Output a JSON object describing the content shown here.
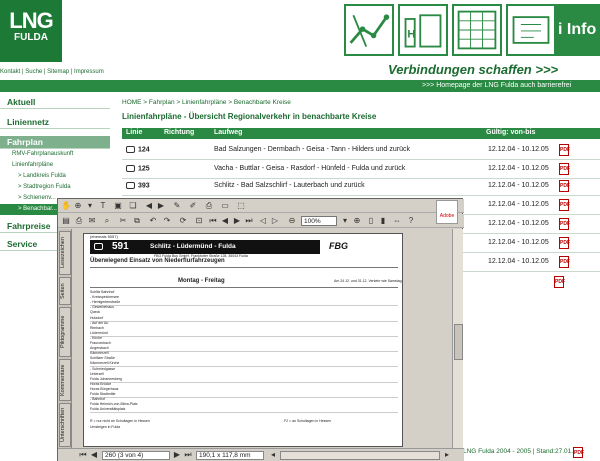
{
  "header": {
    "logo_line1": "LNG",
    "logo_line2": "FULDA",
    "info_tile": "i Info",
    "metalinks": "Kontakt | Suche | Sitemap | Impressum",
    "slogan": "Verbindungen schaffen >>>",
    "greenbar": ">>> Homepage der LNG Fulda auch barrierefrei"
  },
  "sidebar": {
    "items": [
      {
        "label": "Aktuell"
      },
      {
        "label": "Liniennetz"
      },
      {
        "label": "Fahrplan"
      },
      {
        "label": "RMV-Fahrplanauskunft"
      },
      {
        "label": "Linienfahrpläne"
      },
      {
        "label": "> Landkreis Fulda"
      },
      {
        "label": "> Stadtregion Fulda"
      },
      {
        "label": "> Schienenv..."
      },
      {
        "label": "> Benachbar..."
      },
      {
        "label": "Fahrpreise"
      },
      {
        "label": "Service"
      }
    ]
  },
  "main": {
    "breadcrumb": "HOME > Fahrplan > Linienfahrpläne > Benachbarte Kreise",
    "title": "Linienfahrpläne - Übersicht Regionalverkehr in benachbarte Kreise",
    "columns": [
      "Linie",
      "Richtung",
      "Laufweg",
      "Gültig: von-bis"
    ],
    "rows": [
      {
        "linie": "124",
        "laufweg": "Bad Salzungen - Dermbach - Geisa - Tann - Hilders und zurück",
        "gueltig": "12.12.04 - 10.12.05"
      },
      {
        "linie": "125",
        "laufweg": "Vacha - Buttlar - Geisa - Rasdorf - Hünfeld - Fulda und zurück",
        "gueltig": "12.12.04 - 10.12.05"
      },
      {
        "linie": "393",
        "laufweg": "Schlitz - Bad Salzschlirf - Lauterbach und zurück",
        "gueltig": "12.12.04 - 10.12.05"
      },
      {
        "linie": "",
        "laufweg": "",
        "gueltig": "12.12.04 - 10.12.05"
      },
      {
        "linie": "",
        "laufweg": "",
        "gueltig": "12.12.04 - 10.12.05"
      },
      {
        "linie": "",
        "laufweg": "",
        "gueltig": "12.12.04 - 10.12.05"
      },
      {
        "linie": "",
        "laufweg": "",
        "gueltig": "12.12.04 - 10.12.05"
      }
    ],
    "footer": "LNG Fulda 2004 - 2005 | Stand:27.01.05"
  },
  "viewer": {
    "zoom": "100%",
    "brand": "Adobe",
    "page_indicator": "260 (3 von 4)",
    "dimensions": "190,1 x 117,8 mm",
    "side_tabs": [
      "Lesezeichen",
      "Seiten",
      "Piktogramme",
      "Kommentare",
      "Unterschriften"
    ],
    "doc": {
      "route_number": "591",
      "route_name": "Schlitz - Lüdermünd - Fulda",
      "company": "FBG",
      "note_top": "(ehemals 5057)",
      "address": "FBG Fulda Bus GmbH, Frankfurter Straße 128, 36043 Fulda",
      "subtitle": "Überwiegend Einsatz von Niederflurfahrzeugen",
      "day_label": "Montag - Freitag",
      "saturday_note": "Am 24.12. und 31.12. Verkehr wie Samstag",
      "stops": [
        "Schlitz Bahnhof",
        "- Kreisspeichersee",
        "- Hemigertenstraße",
        "- Gewerbehaus",
        "Queck",
        "Hutzdorf",
        "- Auf der Au",
        "Rimbach",
        "Lüdermünd",
        "- Kirche",
        "Fraurombach",
        "Angersbach",
        "Kämmerzell",
        "Schlitzer Straße",
        "Kämmerzell Kirche",
        "- Schmiedgasse",
        "Unterzell",
        "Fulda Johannesberg",
        "Horas Brücke",
        "Horas Bürgerhaus",
        "Fulda Stadtmitte",
        "- Bahnhof",
        "Fulda Heinrich-von-Bibra-Platz",
        "Fulda Universitätsplatz"
      ],
      "footnote_1": "R = nur nicht an Schultagen in Hessen",
      "footnote_2": "F2 = an Schultagen in Hessen",
      "footnote_3": "Umsteigen in Fulda"
    }
  }
}
